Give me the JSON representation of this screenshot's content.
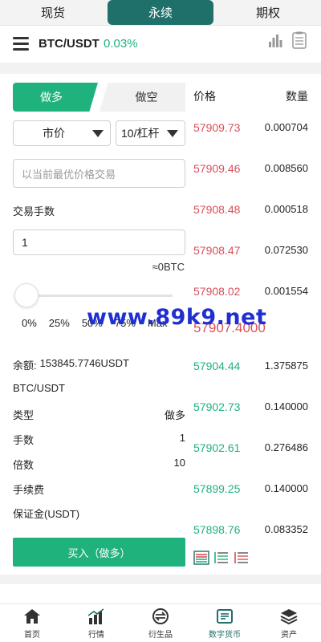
{
  "top_tabs": [
    {
      "label": "现货",
      "active": false
    },
    {
      "label": "永续",
      "active": true
    },
    {
      "label": "期权",
      "active": false
    }
  ],
  "header": {
    "pair": "BTC/USDT",
    "change": "0.03%",
    "change_color": "#1fb27c"
  },
  "trade": {
    "side_long": "做多",
    "side_short": "做空",
    "order_type": "市价",
    "leverage": "10/杠杆",
    "price_placeholder": "以当前最优价格交易",
    "fee_label": "交易手数",
    "quantity": "1",
    "approx": "≈0BTC",
    "percent_options": [
      "0%",
      "25%",
      "50%",
      "75%",
      "Max"
    ],
    "slider_value": 0,
    "balance_label": "余额:",
    "balance_value": "153845.7746USDT",
    "pair_label": "BTC/USDT",
    "info": [
      {
        "label": "类型",
        "value": "做多"
      },
      {
        "label": "手数",
        "value": "1"
      },
      {
        "label": "倍数",
        "value": "10"
      },
      {
        "label": "手续费",
        "value": ""
      },
      {
        "label": "保证金(USDT)",
        "value": ""
      }
    ],
    "buy_button": "买入（做多）"
  },
  "order_book": {
    "price_header": "价格",
    "qty_header": "数量",
    "asks": [
      {
        "price": "57909.73",
        "qty": "0.000704"
      },
      {
        "price": "57909.46",
        "qty": "0.008560"
      },
      {
        "price": "57908.48",
        "qty": "0.000518"
      },
      {
        "price": "57908.47",
        "qty": "0.072530"
      },
      {
        "price": "57908.02",
        "qty": "0.001554"
      }
    ],
    "mid_price": "57907.4000",
    "bids": [
      {
        "price": "57904.44",
        "qty": "1.375875"
      },
      {
        "price": "57902.73",
        "qty": "0.140000"
      },
      {
        "price": "57902.61",
        "qty": "0.276486"
      },
      {
        "price": "57899.25",
        "qty": "0.140000"
      },
      {
        "price": "57898.76",
        "qty": "0.083352"
      }
    ],
    "ask_color": "#d8505a",
    "bid_color": "#1fb27c"
  },
  "watermark": "www.89k9.net",
  "nav": [
    {
      "label": "首页",
      "icon": "home-icon",
      "active": false
    },
    {
      "label": "行情",
      "icon": "market-icon",
      "active": false
    },
    {
      "label": "衍生品",
      "icon": "derivatives-icon",
      "active": false
    },
    {
      "label": "数字货币",
      "icon": "crypto-icon",
      "active": true
    },
    {
      "label": "资产",
      "icon": "assets-icon",
      "active": false
    }
  ]
}
